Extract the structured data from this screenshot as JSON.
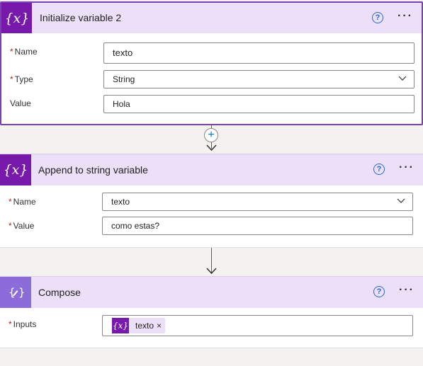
{
  "card1": {
    "title": "Initialize variable 2",
    "icon": "variable-icon",
    "fields": {
      "name_label": "Name",
      "name_value": "texto",
      "type_label": "Type",
      "type_value": "String",
      "value_label": "Value",
      "value_value": "Hola"
    }
  },
  "card2": {
    "title": "Append to string variable",
    "icon": "variable-icon",
    "fields": {
      "name_label": "Name",
      "name_value": "texto",
      "value_label": "Value",
      "value_value": "como estas?"
    }
  },
  "card3": {
    "title": "Compose",
    "icon": "compose-icon",
    "fields": {
      "inputs_label": "Inputs",
      "token_text": "texto",
      "token_icon": "{x}",
      "token_remove": "×"
    }
  },
  "common": {
    "required_mark": "*",
    "help": "?",
    "more": "···",
    "add": "+"
  },
  "colors": {
    "accent": "#7719aa",
    "compose": "#8c6cd9",
    "header": "#ebe0f7",
    "link": "#2b67c6",
    "required": "#a4262c"
  }
}
